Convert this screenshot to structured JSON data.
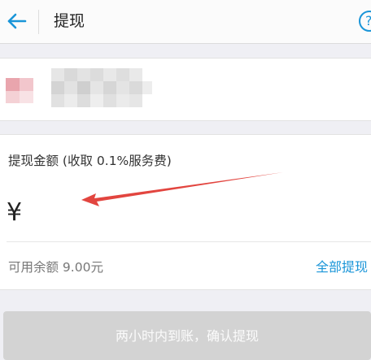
{
  "header": {
    "title": "提现",
    "back_icon": "arrow-left-icon",
    "help_icon": "help-circle-icon",
    "help_glyph": "?"
  },
  "account_card": {
    "bank_logo_icon": "bank-logo-icon"
  },
  "amount_section": {
    "label": "提现金额 (收取 0.1%服务费)",
    "currency_symbol": "¥",
    "available_text": "可用余额 9.00元",
    "withdraw_all_label": "全部提现"
  },
  "confirm_button": {
    "label": "两小时内到账，确认提现"
  },
  "colors": {
    "accent": "#1a95d8",
    "arrow": "#e2453f",
    "button_disabled": "#d3d3d3"
  }
}
